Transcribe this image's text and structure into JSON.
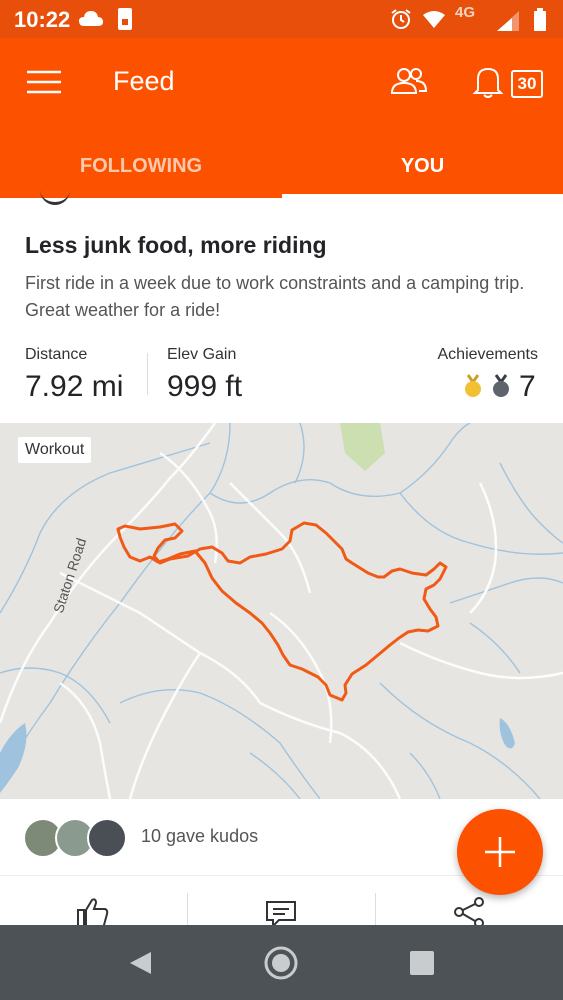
{
  "status": {
    "time": "10:22",
    "network": "4G"
  },
  "header": {
    "title": "Feed",
    "notification_count": "30"
  },
  "tabs": [
    {
      "label": "FOLLOWING",
      "active": false
    },
    {
      "label": "YOU",
      "active": true
    }
  ],
  "activity": {
    "title": "Less junk food, more riding",
    "description": "First ride in a week due to work constraints and a camping trip. Great weather for a ride!",
    "stats": {
      "distance_label": "Distance",
      "distance_value": "7.92 mi",
      "elev_label": "Elev Gain",
      "elev_value": "999 ft",
      "achievements_label": "Achievements",
      "achievements_value": "7"
    },
    "map": {
      "tag": "Workout",
      "road_label": "Staton Road"
    }
  },
  "kudos": {
    "text": "10 gave kudos"
  },
  "colors": {
    "brand": "#fc5200",
    "route": "#f05a16",
    "gold": "#f2c033",
    "medal_gray": "#5f646c"
  },
  "icons": [
    "menu-icon",
    "athletes-icon",
    "bell-icon",
    "thumbs-up-icon",
    "comment-icon",
    "share-icon",
    "plus-icon",
    "back-icon",
    "home-icon",
    "recents-icon"
  ]
}
